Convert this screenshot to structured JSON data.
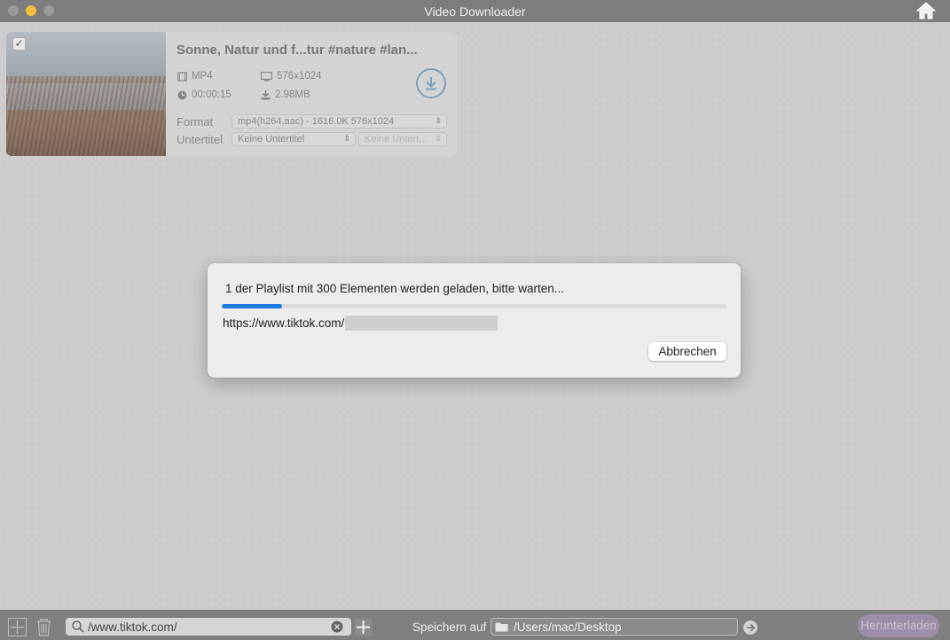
{
  "window": {
    "title": "Video Downloader"
  },
  "video": {
    "title": "Sonne, Natur und f...tur #nature #lan...",
    "format_type": "MP4",
    "resolution": "576x1024",
    "duration": "00:00:15",
    "size": "2.98MB",
    "format_label": "Format",
    "format_value": "mp4(h264,aac) - 1616.0K 576x1024",
    "subtitle_label": "Untertitel",
    "subtitle_value": "Keine Untertitel",
    "subtitle_second": "Keine Untert..."
  },
  "modal": {
    "message": "1 der Playlist mit 300 Elementen werden geladen, bitte warten...",
    "progress_percent": 12,
    "url_prefix": "https://www.tiktok.com/",
    "cancel_label": "Abbrechen"
  },
  "bottom": {
    "search_value": "/www.tiktok.com/",
    "save_label": "Speichern auf",
    "save_path": "/Users/mac/Desktop",
    "download_label": "Herunterladen"
  },
  "colors": {
    "accent": "#1b7ae0",
    "traffic_yellow": "#f6be3a"
  }
}
